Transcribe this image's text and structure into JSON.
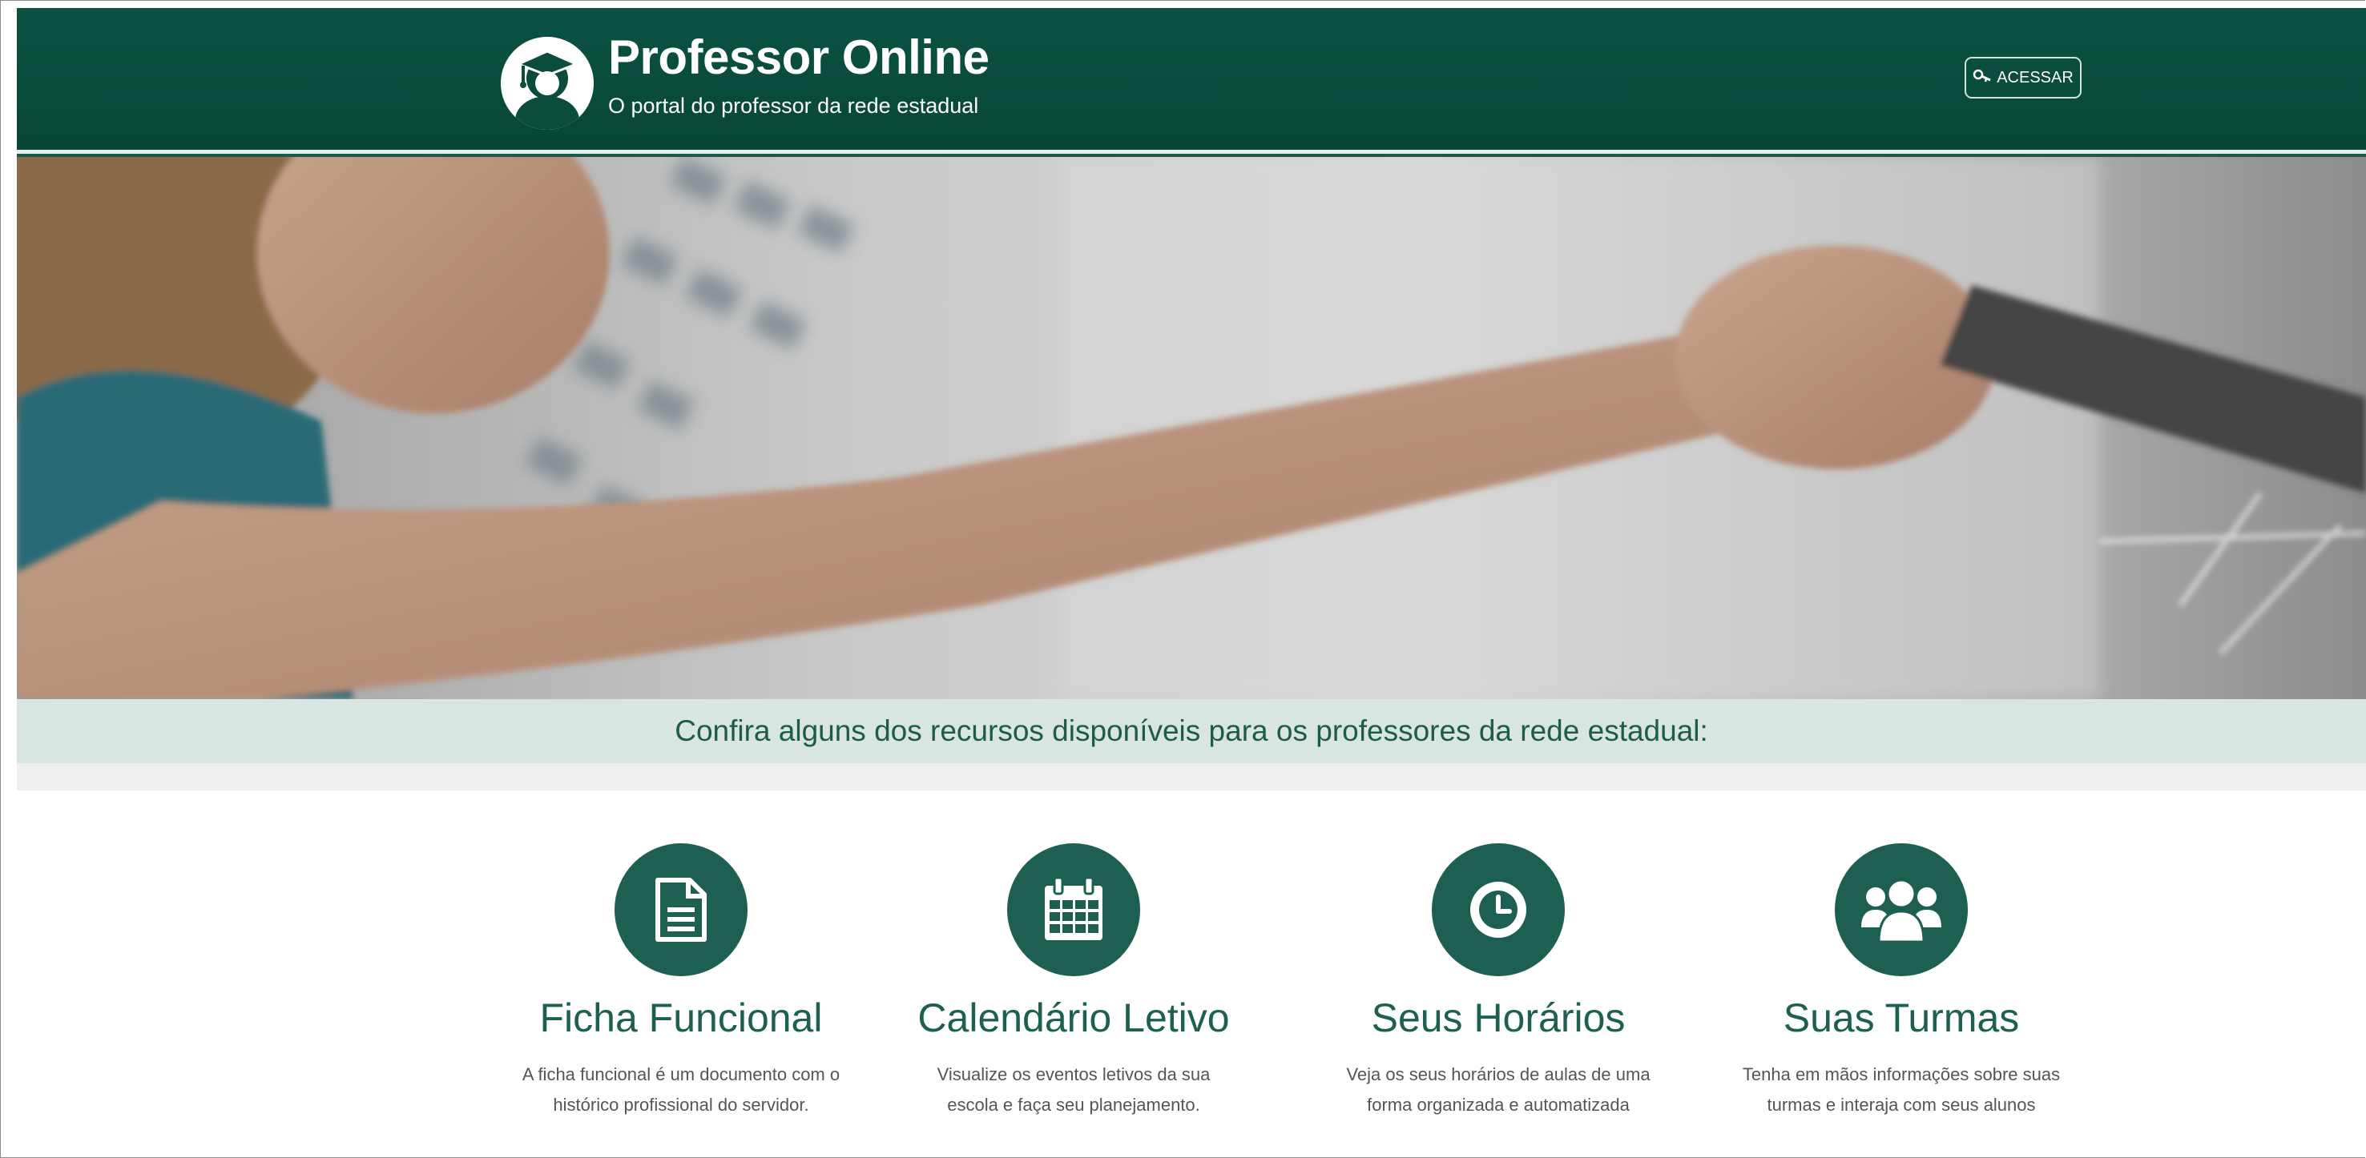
{
  "header": {
    "brand_title": "Professor Online",
    "brand_subtitle": "O portal do professor da rede estadual",
    "access_label": "ACESSAR",
    "logo_icon": "graduate-avatar-icon",
    "access_icon": "key-icon"
  },
  "banner": {
    "text": "Confira alguns dos recursos disponíveis para os professores da rede estadual:"
  },
  "features": [
    {
      "icon": "document-icon",
      "title": "Ficha Funcional",
      "desc": "A ficha funcional é um documento com o\nhistórico profissional do servidor."
    },
    {
      "icon": "calendar-icon",
      "title": "Calendário Letivo",
      "desc": "Visualize os eventos letivos da sua\nescola e faça seu planejamento."
    },
    {
      "icon": "clock-icon",
      "title": "Seus Horários",
      "desc": "Veja os seus horários de aulas de uma\nforma organizada e automatizada"
    },
    {
      "icon": "group-icon",
      "title": "Suas Turmas",
      "desc": "Tenha em mãos informações sobre suas\nturmas e interaja com seus alunos"
    }
  ],
  "colors": {
    "header_bg": "#0a4d3d",
    "accent": "#1d5f50",
    "banner_bg": "#d8e5e0"
  }
}
